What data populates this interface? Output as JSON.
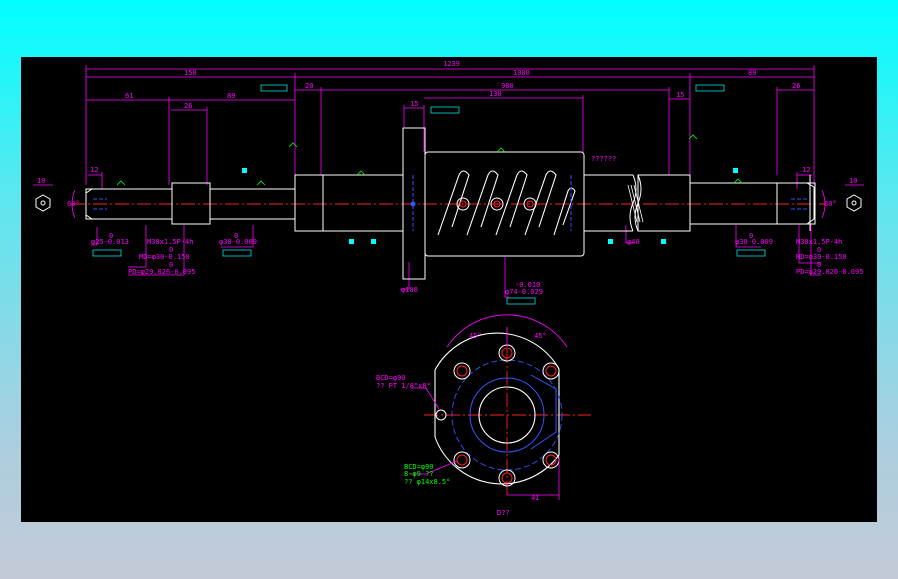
{
  "drawing": {
    "dims_top": {
      "overall": "1239",
      "left_end": "150",
      "mid": "1000",
      "right_end": "89",
      "d61": "61",
      "d89": "89",
      "d26_left": "26",
      "d20": "20",
      "d980": "980",
      "d15": "15",
      "d130": "130",
      "d15_right": "15",
      "d26_right": "26",
      "d12_left": "12",
      "d12_right": "12",
      "d10_left": "10",
      "d10_right": "10"
    },
    "angles": {
      "left": "60°",
      "right": "60°"
    },
    "question_mark_label": "??????",
    "notes_left": {
      "phi25": "φ25-0.013",
      "phi25_zero": "0",
      "thread": "M30x1.5P-4h",
      "md_zero": "0",
      "md": "MD=φ30-0.150",
      "pd_zero": "0",
      "pd": "PD=φ29.026-0.095",
      "phi30_zero": "0",
      "phi30": "φ30-0.009"
    },
    "notes_right": {
      "phi30_zero": "0",
      "phi30": "φ30-0.009",
      "thread": "M30x1.5P-4h",
      "md_zero": "0",
      "md": "MD=φ30-0.150",
      "pd_zero": "0",
      "pd": "PD=φ29.026-0.095"
    },
    "notes_nut": {
      "phi40": "φ40",
      "phi108": "φ108",
      "tol_top": "-0.010",
      "phi74": "φ74-0.029"
    },
    "flange": {
      "angle_left": "45°",
      "angle_right": "45°",
      "bcd_oil": "BCD=φ90",
      "oil": "?? PT 1/8\"x8°",
      "bcd_bolt": "BCD=φ90",
      "holes": "8-φ9 ??",
      "counterbore": "?? φ14x8.5°",
      "dim41": "41",
      "view_label": "D??"
    }
  }
}
